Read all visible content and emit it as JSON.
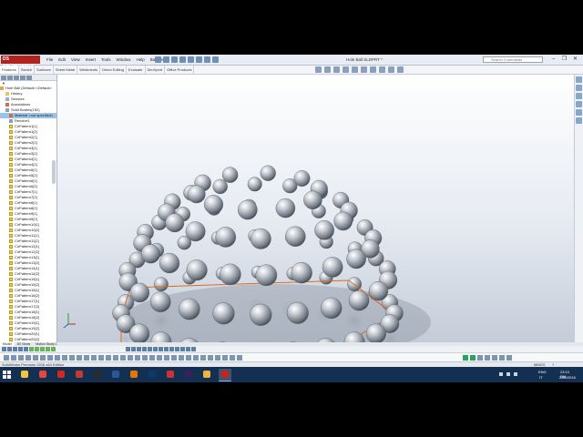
{
  "app": {
    "logo": "DS SOLIDWORKS",
    "document_title": "Hole Ball.SLDPRT *",
    "search_placeholder": "Search Commands",
    "menus": [
      "File",
      "Edit",
      "View",
      "Insert",
      "Tools",
      "Window",
      "Help",
      "Ball Setup"
    ]
  },
  "command_tabs": [
    "Features",
    "Sketch",
    "Surfaces",
    "Sheet Metal",
    "Weldments",
    "Direct Editing",
    "Evaluate",
    "DimXpert",
    "Office Products"
  ],
  "tree": {
    "root": "Hole Ball  (Default<<Default>",
    "items": [
      {
        "label": "History",
        "icon": "folder-icon"
      },
      {
        "label": "Sensors",
        "icon": "sensor-icon"
      },
      {
        "label": "Annotations",
        "icon": "annotation-icon"
      },
      {
        "label": "Solid Bodies(192)",
        "icon": "solid-body-icon"
      },
      {
        "label": "Material <not specified>",
        "icon": "material-icon"
      },
      {
        "label": "Revolve1",
        "icon": "revolve-icon"
      },
      {
        "label": "CirPattern1[1]",
        "icon": "circular-pattern-icon"
      },
      {
        "label": "CirPattern1[2]",
        "icon": "circular-pattern-icon"
      },
      {
        "label": "CirPattern2[1]",
        "icon": "circular-pattern-icon"
      },
      {
        "label": "CirPattern2[2]",
        "icon": "circular-pattern-icon"
      },
      {
        "label": "CirPattern3[1]",
        "icon": "circular-pattern-icon"
      },
      {
        "label": "CirPattern3[2]",
        "icon": "circular-pattern-icon"
      },
      {
        "label": "CirPattern4[1]",
        "icon": "circular-pattern-icon"
      },
      {
        "label": "CirPattern4[2]",
        "icon": "circular-pattern-icon"
      },
      {
        "label": "CirPattern5[1]",
        "icon": "circular-pattern-icon"
      },
      {
        "label": "CirPattern5[2]",
        "icon": "circular-pattern-icon"
      },
      {
        "label": "CirPattern6[1]",
        "icon": "circular-pattern-icon"
      },
      {
        "label": "CirPattern6[2]",
        "icon": "circular-pattern-icon"
      },
      {
        "label": "CirPattern7[1]",
        "icon": "circular-pattern-icon"
      },
      {
        "label": "CirPattern7[2]",
        "icon": "circular-pattern-icon"
      },
      {
        "label": "CirPattern8[1]",
        "icon": "circular-pattern-icon"
      },
      {
        "label": "CirPattern8[2]",
        "icon": "circular-pattern-icon"
      },
      {
        "label": "CirPattern9[1]",
        "icon": "circular-pattern-icon"
      },
      {
        "label": "CirPattern9[2]",
        "icon": "circular-pattern-icon"
      },
      {
        "label": "CirPattern10[1]",
        "icon": "circular-pattern-icon"
      },
      {
        "label": "CirPattern10[2]",
        "icon": "circular-pattern-icon"
      },
      {
        "label": "CirPattern11[1]",
        "icon": "circular-pattern-icon"
      },
      {
        "label": "CirPattern11[2]",
        "icon": "circular-pattern-icon"
      },
      {
        "label": "CirPattern12[1]",
        "icon": "circular-pattern-icon"
      },
      {
        "label": "CirPattern12[2]",
        "icon": "circular-pattern-icon"
      },
      {
        "label": "CirPattern13[1]",
        "icon": "circular-pattern-icon"
      },
      {
        "label": "CirPattern13[2]",
        "icon": "circular-pattern-icon"
      },
      {
        "label": "CirPattern14[1]",
        "icon": "circular-pattern-icon"
      },
      {
        "label": "CirPattern14[2]",
        "icon": "circular-pattern-icon"
      },
      {
        "label": "CirPattern15[1]",
        "icon": "circular-pattern-icon"
      },
      {
        "label": "CirPattern15[2]",
        "icon": "circular-pattern-icon"
      },
      {
        "label": "CirPattern16[1]",
        "icon": "circular-pattern-icon"
      },
      {
        "label": "CirPattern16[2]",
        "icon": "circular-pattern-icon"
      },
      {
        "label": "CirPattern17[1]",
        "icon": "circular-pattern-icon"
      },
      {
        "label": "CirPattern17[2]",
        "icon": "circular-pattern-icon"
      },
      {
        "label": "CirPattern18[1]",
        "icon": "circular-pattern-icon"
      },
      {
        "label": "CirPattern18[2]",
        "icon": "circular-pattern-icon"
      },
      {
        "label": "CirPattern19[1]",
        "icon": "circular-pattern-icon"
      },
      {
        "label": "CirPattern19[2]",
        "icon": "circular-pattern-icon"
      },
      {
        "label": "CirPattern20[1]",
        "icon": "circular-pattern-icon"
      },
      {
        "label": "CirPattern20[2]",
        "icon": "circular-pattern-icon"
      },
      {
        "label": "CirPattern21[1]",
        "icon": "circular-pattern-icon"
      },
      {
        "label": "CirPattern21[2]",
        "icon": "circular-pattern-icon"
      },
      {
        "label": "CirPattern22[1]",
        "icon": "circular-pattern-icon"
      },
      {
        "label": "CirPattern22[2]",
        "icon": "circular-pattern-icon"
      }
    ]
  },
  "bottom_tabs": [
    "Model",
    "3D Views",
    "Motion Study 1"
  ],
  "status": {
    "left": "SolidWorks Premium 2016 x64 Edition",
    "units": "MMGS",
    "help_icon": "?"
  },
  "taskbar": {
    "language": "ENG",
    "region": "IT",
    "time": "23:10 PM",
    "date": "28/6/2016",
    "apps": [
      "file-explorer-icon",
      "chrome-icon",
      "acrobat-icon",
      "wps-icon",
      "kodi-icon",
      "word-icon",
      "blender-icon",
      "photoshop-icon",
      "paint-icon",
      "premiere-icon",
      "folder-icon",
      "solidworks-icon"
    ]
  },
  "colors": {
    "brand_red": "#b1231c",
    "taskbar": "#132f52",
    "selection": "#9dc3e6",
    "sketch_line": "#e06a1d"
  }
}
